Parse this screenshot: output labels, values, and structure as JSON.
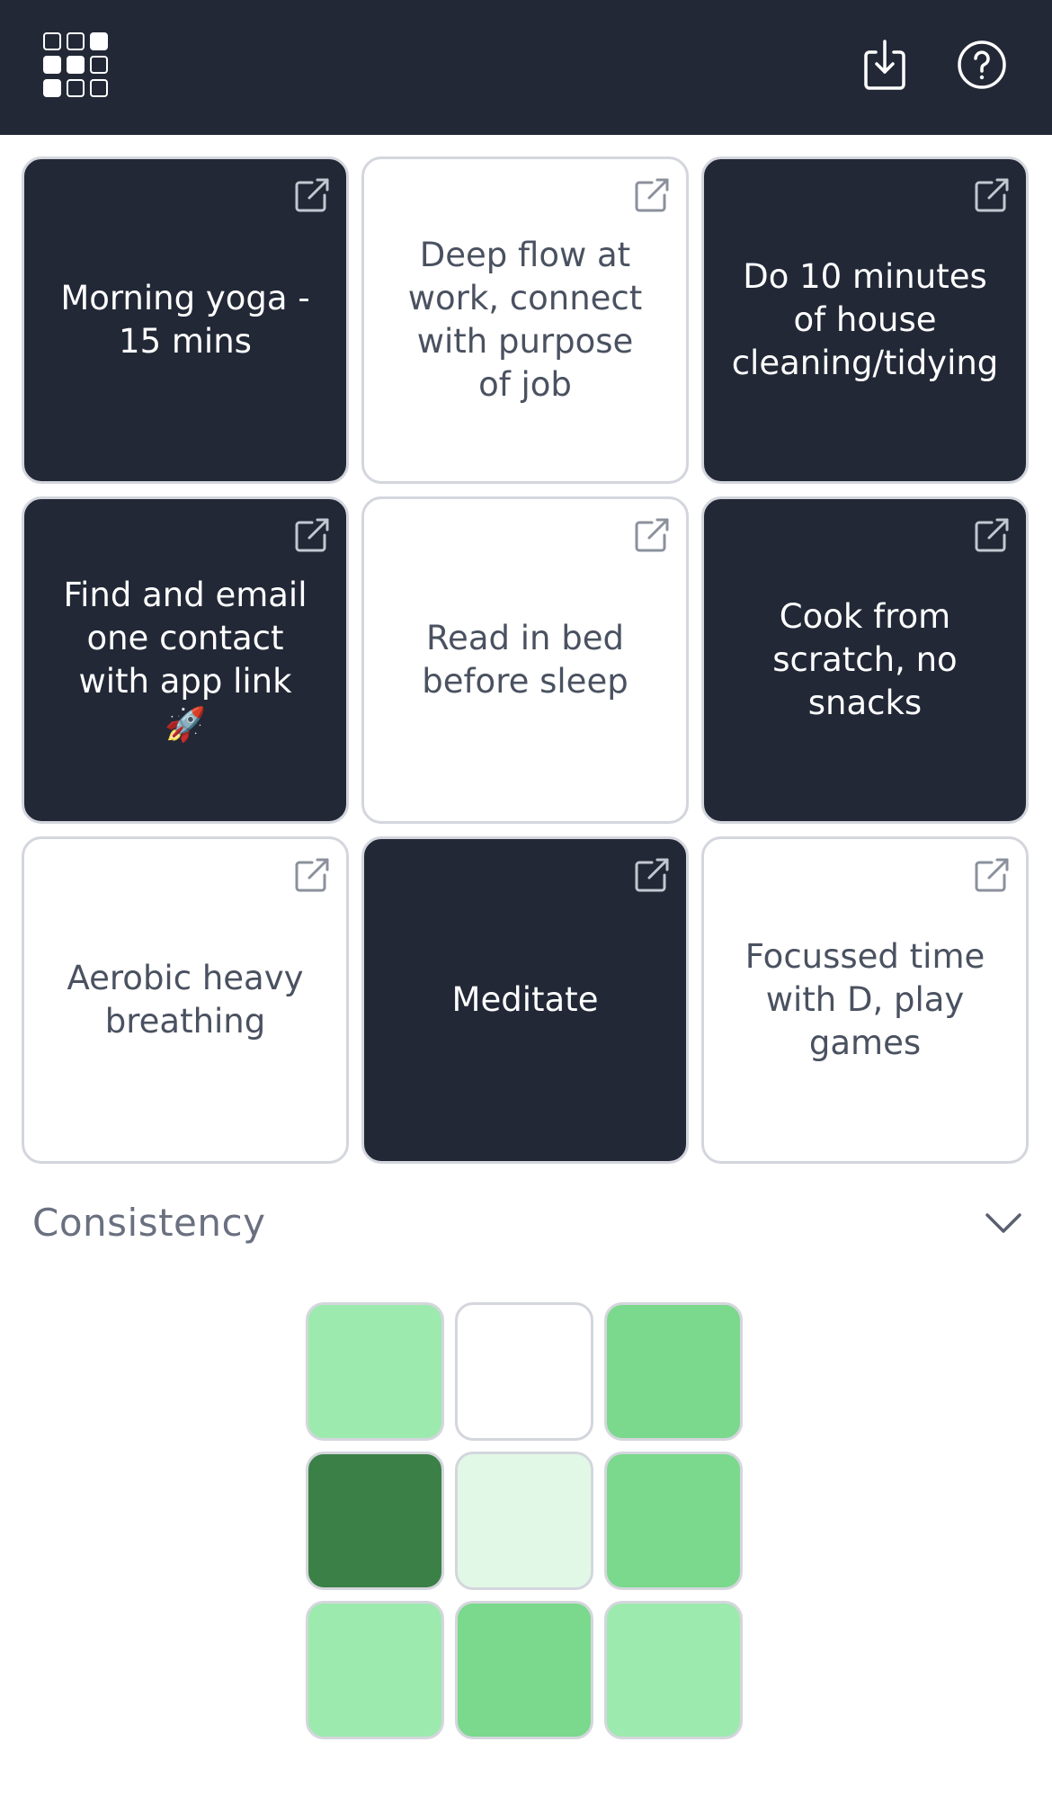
{
  "header": {
    "logo_icon": "grid-logo-icon",
    "download_icon": "download-icon",
    "help_icon": "help-icon",
    "background": "#222836"
  },
  "cards": [
    {
      "text": "Morning yoga - 15 mins",
      "done": true
    },
    {
      "text": "Deep flow at work, connect with purpose of job",
      "done": false
    },
    {
      "text": "Do 10 minutes of house cleaning/tidying",
      "done": true
    },
    {
      "text": "Find and email one contact with app link 🚀",
      "done": true
    },
    {
      "text": "Read in bed before sleep",
      "done": false
    },
    {
      "text": "Cook from scratch, no snacks",
      "done": true
    },
    {
      "text": "Aerobic heavy breathing",
      "done": false
    },
    {
      "text": "Meditate",
      "done": true
    },
    {
      "text": "Focussed time with D, play games",
      "done": false
    }
  ],
  "consistency": {
    "title": "Consistency",
    "toggle_icon": "chevron-down-icon",
    "cells": [
      "#9deaae",
      "#ffffff",
      "#7ad98c",
      "#3b8046",
      "#e2f8e7",
      "#7ad98c",
      "#9deaae",
      "#7ad98c",
      "#9deaae"
    ]
  },
  "colors": {
    "done_bg": "#222836",
    "pending_bg": "#ffffff",
    "border": "#d4d6dd",
    "muted_text": "#6a7080"
  }
}
